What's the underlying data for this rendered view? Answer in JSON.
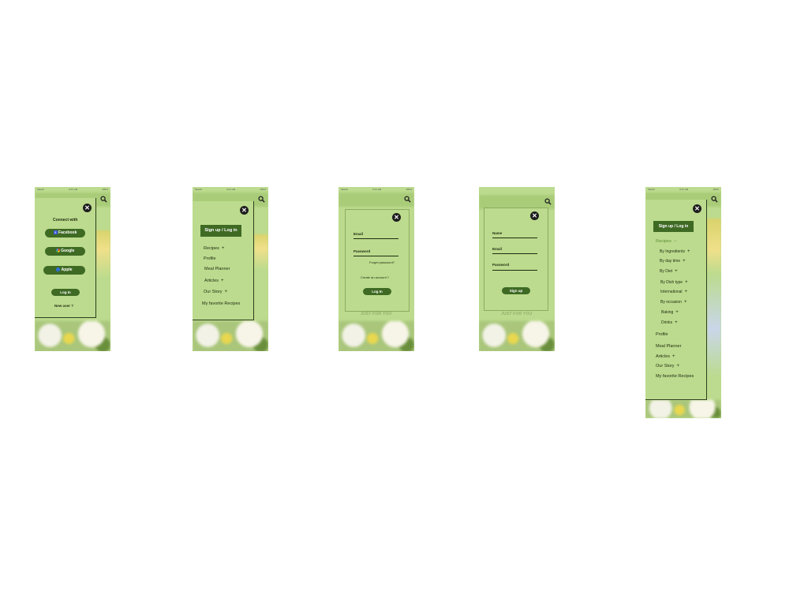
{
  "status": {
    "carrier": "Sketch",
    "time": "9:41 AM",
    "battery": "100%"
  },
  "screen1": {
    "heading": "Connect with",
    "facebook": "Facebook",
    "google": "Google",
    "apple": "Apple",
    "login": "Log In",
    "new_user": "New user ?"
  },
  "screen2": {
    "signup_login": "Sign up / Log in",
    "recipes": "Recipes",
    "profile": "Profile",
    "meal_planner": "Meal Planner",
    "articles": "Articles",
    "our_story": "Our Story",
    "favorites": "My favorite Recipes",
    "plus": "+"
  },
  "screen3": {
    "email": "Email",
    "password": "Password",
    "forgot": "Forget password?",
    "create": "Create an account ?",
    "login": "Log In",
    "bg_caption": "JUST FOR YOU"
  },
  "screen4": {
    "name": "Name",
    "email": "Email",
    "password": "Password",
    "signup": "Sign up",
    "bg_caption": "JUST FOR YOU"
  },
  "screen5": {
    "signup_login": "Sign up / Log in",
    "recipes": "Recipes",
    "recipes_minus": "−",
    "sub": [
      "By Ingredients",
      "By day time",
      "By Diet",
      "By Dish type",
      "International",
      "By occasion",
      "Baking",
      "Drinks"
    ],
    "profile": "Profile",
    "meal_planner": "Meal Planner",
    "articles": "Articles",
    "our_story": "Our Story",
    "favorites": "My favorite Recipes",
    "plus": "+"
  },
  "icons": {
    "close": "close-icon",
    "search": "search-icon",
    "facebook": "facebook-icon",
    "google": "google-icon",
    "apple": "apple-icon"
  }
}
